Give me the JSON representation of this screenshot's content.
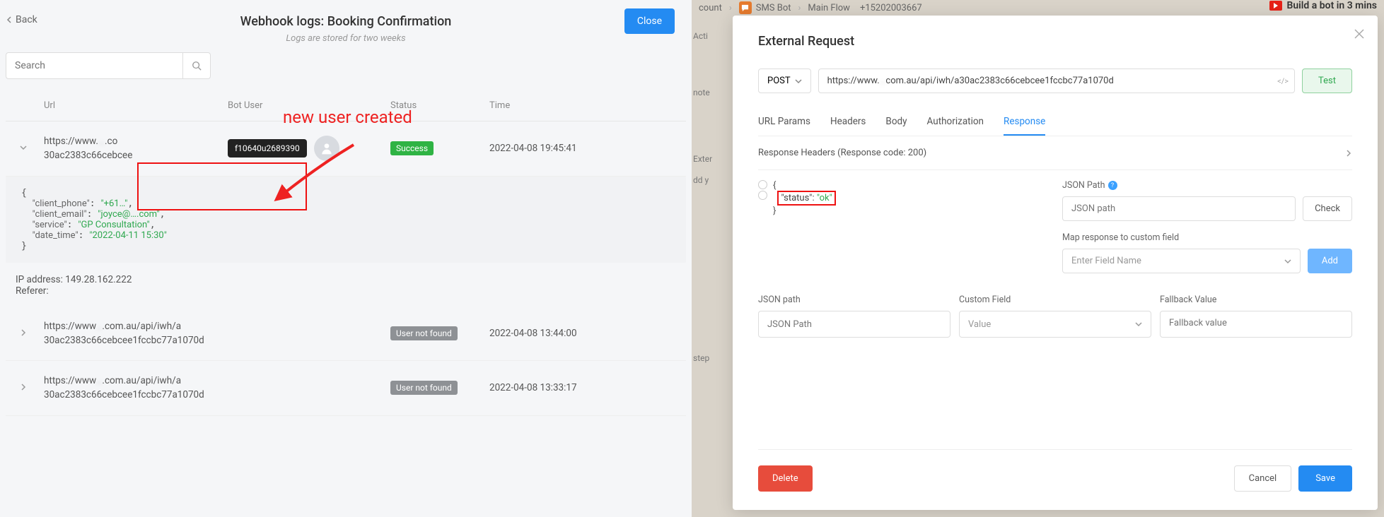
{
  "left": {
    "back": "Back",
    "title": "Webhook logs: Booking Confirmation",
    "subtitle": "Logs are stored for two weeks",
    "close": "Close",
    "search_placeholder": "Search",
    "columns": {
      "url": "Url",
      "user": "Bot User",
      "status": "Status",
      "time": "Time"
    },
    "rows": [
      {
        "url_a": "https://www.",
        "url_obsc": "…",
        "url_b": ".co",
        "url_c": "30ac2383c66cebcee",
        "user_id": "f10640u2689390",
        "status": "Success",
        "status_kind": "success",
        "time": "2022-04-08 19:45:41"
      },
      {
        "url_a": "https://www",
        "url_obsc": "…",
        "url_b": ".com.au/api/iwh/a",
        "url_c": "30ac2383c66cebcee1fccbc77a1070d",
        "status": "User not found",
        "status_kind": "grey",
        "time": "2022-04-08 13:44:00"
      },
      {
        "url_a": "https://www",
        "url_obsc": "…",
        "url_b": ".com.au/api/iwh/a",
        "url_c": "30ac2383c66cebcee1fccbc77a1070d",
        "status": "User not found",
        "status_kind": "grey",
        "time": "2022-04-08 13:33:17"
      }
    ],
    "detail": {
      "client_phone_k": "\"client_phone\"",
      "client_phone_v": "\"+61…\"",
      "client_email_k": "\"client_email\"",
      "client_email_v": "\"joyce@….com\"",
      "service_k": "\"service\"",
      "service_v": "\"GP Consultation\"",
      "date_time_k": "\"date_time\"",
      "date_time_v": "\"2022-04-11 15:30\"",
      "ip": "IP address: 149.28.162.222",
      "ref": "Referer:"
    },
    "annotation": "new user created"
  },
  "right": {
    "crumb": {
      "account": "count",
      "sms": "SMS Bot",
      "flow": "Main Flow",
      "phone": "+15202003667",
      "build": "Build a bot in 3 mins"
    },
    "snippets": {
      "acti": "Acti",
      "note": "note",
      "exter": "Exter",
      "addy": "dd y",
      "step": "step"
    },
    "modal": {
      "title": "External Request",
      "method": "POST",
      "url_a": "https://www.",
      "url_obsc": "…",
      "url_b": "com.au/api/iwh/a30ac2383c66cebcee1fccbc77a1070d",
      "test": "Test",
      "tabs": {
        "params": "URL Params",
        "headers": "Headers",
        "body": "Body",
        "auth": "Authorization",
        "resp": "Response"
      },
      "resp_header": "Response Headers (Response code: 200)",
      "json": {
        "open": "{",
        "status_k": "\"status\"",
        "status_v": "\"ok\"",
        "close": "}"
      },
      "jsonpath_lbl": "JSON Path",
      "jsonpath_ph": "JSON path",
      "check": "Check",
      "map_lbl": "Map response to custom field",
      "field_ph": "Enter Field Name",
      "add": "Add",
      "cols": {
        "jp": "JSON path",
        "cf": "Custom Field",
        "fb": "Fallback Value"
      },
      "ph": {
        "jp": "JSON Path",
        "cf": "Value",
        "fb": "Fallback value"
      },
      "delete": "Delete",
      "cancel": "Cancel",
      "save": "Save"
    }
  }
}
